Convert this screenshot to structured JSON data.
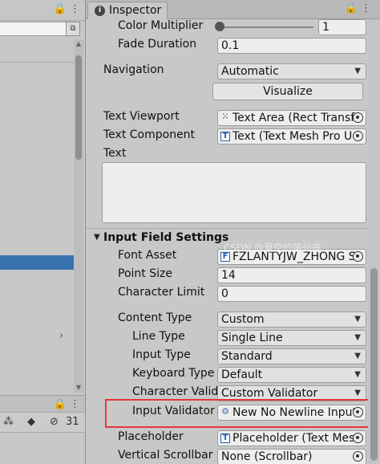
{
  "left_panel": {
    "top_tab_icons": "🔒 ⋮",
    "bottom_tab_icons": "🔒 ⋮",
    "bottom_bar_count": "31"
  },
  "inspector": {
    "tab_label": "Inspector",
    "tab_icons": "🔒 ⋮",
    "color_multiplier": {
      "label": "Color Multiplier",
      "value": "1"
    },
    "fade_duration": {
      "label": "Fade Duration",
      "value": "0.1"
    },
    "navigation": {
      "label": "Navigation",
      "value": "Automatic"
    },
    "visualize_label": "Visualize",
    "text_viewport": {
      "label": "Text Viewport",
      "value": "Text Area (Rect Transf"
    },
    "text_component": {
      "label": "Text Component",
      "value": "Text (Text Mesh Pro U"
    },
    "text_label": "Text",
    "section_title": "Input Field Settings",
    "font_asset": {
      "label": "Font Asset",
      "value": "FZLANTYJW_ZHONG S"
    },
    "point_size": {
      "label": "Point Size",
      "value": "14"
    },
    "character_limit": {
      "label": "Character Limit",
      "value": "0"
    },
    "content_type": {
      "label": "Content Type",
      "value": "Custom"
    },
    "line_type": {
      "label": "Line Type",
      "value": "Single Line"
    },
    "input_type": {
      "label": "Input Type",
      "value": "Standard"
    },
    "keyboard_type": {
      "label": "Keyboard Type",
      "value": "Default"
    },
    "character_validation": {
      "label": "Character Valid",
      "value": "Custom Validator"
    },
    "input_validator": {
      "label": "Input Validator",
      "value": "New No Newline Input"
    },
    "placeholder": {
      "label": "Placeholder",
      "value": "Placeholder (Text Mes"
    },
    "vertical_scrollbar": {
      "label": "Vertical Scrollbar",
      "value": "None (Scrollbar)"
    }
  },
  "watermark": "CSDN @夏空的英仙座",
  "colors": {
    "highlight": "#e5373a",
    "selection": "#3a72b0"
  }
}
